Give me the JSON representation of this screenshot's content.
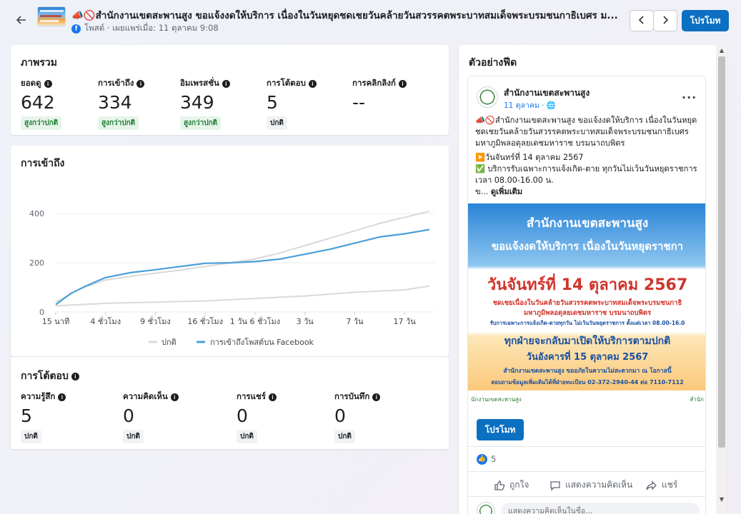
{
  "header": {
    "post_title": "📣🚫สำนักงานเขตสะพานสูง ขอแจ้งงดให้บริการ เนื่องในวันหยุดชดเชยวันคล้ายวันสวรรคตพระบาทสมเด็จพระบรมชนกาธิเบศร ม...",
    "post_meta": "โพสต์ · เผยแพร่เมื่อ: 11 ตุลาคม 9:08",
    "promote_label": "โปรโมท",
    "icons": {
      "back": "arrow-left-icon",
      "prev": "chevron-left-icon",
      "next": "chevron-right-icon",
      "facebook": "facebook-icon"
    }
  },
  "overview": {
    "title": "ภาพรวม",
    "metrics": [
      {
        "label": "ยอดดู",
        "value": "642",
        "status": "สูงกว่าปกติ",
        "level": "up"
      },
      {
        "label": "การเข้าถึง",
        "value": "334",
        "status": "สูงกว่าปกติ",
        "level": "up"
      },
      {
        "label": "อิมเพรสชั่น",
        "value": "349",
        "status": "สูงกว่าปกติ",
        "level": "up"
      },
      {
        "label": "การโต้ตอบ",
        "value": "5",
        "status": "ปกติ",
        "level": "norm"
      },
      {
        "label": "การคลิกลิงก์",
        "value": "--",
        "status": "",
        "level": "none"
      }
    ]
  },
  "reach_chart": {
    "title": "การเข้าถึง",
    "legend_normal": "ปกติ",
    "legend_series": "การเข้าถึงโพสต์บน Facebook",
    "colors": {
      "series": "#4a9fd8",
      "normal": "#d9d9d9"
    }
  },
  "chart_data": {
    "type": "line",
    "title": "การเข้าถึง",
    "x_ticks": [
      "15 นาที",
      "4 ชั่วโมง",
      "9 ชั่วโมง",
      "16 ชั่วโมง",
      "1 วัน 6 ชั่วโมง",
      "3 วัน",
      "7 วัน",
      "17 วัน"
    ],
    "x_tick_positions": [
      0,
      1,
      2,
      3,
      4,
      5,
      6,
      7
    ],
    "ylim": [
      0,
      450
    ],
    "y_ticks": [
      0,
      200,
      400
    ],
    "grid": true,
    "legend": "bottom",
    "series": [
      {
        "name": "การเข้าถึงโพสต์บน Facebook",
        "x": [
          0,
          0.3,
          0.6,
          1,
          1.5,
          2,
          2.5,
          3,
          3.5,
          4,
          4.5,
          5,
          5.5,
          6,
          6.5,
          7,
          7.5
        ],
        "values": [
          30,
          75,
          105,
          140,
          160,
          172,
          185,
          198,
          200,
          205,
          215,
          235,
          255,
          280,
          305,
          318,
          335
        ]
      },
      {
        "name": "ปกติ",
        "x": [
          0,
          0.5,
          1,
          1.5,
          2,
          2.5,
          3,
          3.5,
          4,
          4.5,
          5,
          5.5,
          6,
          6.5,
          7,
          7.5
        ],
        "values": [
          40,
          95,
          130,
          145,
          158,
          170,
          185,
          200,
          215,
          240,
          270,
          300,
          330,
          360,
          385,
          410
        ]
      },
      {
        "name": "ปกติ-ต่ำ",
        "x": [
          0,
          1,
          2,
          3,
          4,
          5,
          6,
          7,
          7.5
        ],
        "values": [
          25,
          35,
          40,
          45,
          55,
          65,
          80,
          90,
          105
        ]
      }
    ]
  },
  "engagement": {
    "title": "การโต้ตอบ",
    "metrics": [
      {
        "label": "ความรู้สึก",
        "value": "5",
        "status": "ปกติ"
      },
      {
        "label": "ความคิดเห็น",
        "value": "0",
        "status": "ปกติ"
      },
      {
        "label": "การแชร์",
        "value": "0",
        "status": "ปกติ"
      },
      {
        "label": "การบันทึก",
        "value": "0",
        "status": "ปกติ"
      }
    ]
  },
  "feed": {
    "title": "ตัวอย่างฟีด",
    "page_name": "สำนักงานเขตสะพานสูง",
    "date": "11 ตุลาคม · 🌐",
    "text_line1": "📣🚫สำนักงานเขตสะพานสูง ขอแจ้งงดให้บริการ เนื่องในวันหยุดชดเชยวันคล้ายวันสวรรคตพระบาทสมเด็จพระบรมชนกาธิเบศร มหาภูมิพลอดุลยเดชมหาราช บรมนาถบพิตร",
    "text_line2": "▶️วันจันทร์ที่ 14 ตุลาคม 2567",
    "text_line3": "✅ บริการรับเฉพาะการแจ้งเกิด-ตาย ทุกวันไม่เว้นวันหยุดราชการ เวลา 08.00-16.00 น.",
    "text_line4_prefix": "ข... ",
    "see_more": "ดูเพิ่มเติม",
    "image": {
      "line1": "สำนักงานเขตสะพานสูง",
      "line2": "ขอแจ้งงดให้บริการ เนื่องในวันหยุดราชกา",
      "line3": "วันจันทร์ที่ 14 ตุลาคม 2567",
      "line4": "ชดเชยเนื่องในวันคล้ายวันสวรรคตพระบาทสมเด็จพระบรมชนกาธิ",
      "line5": "มหาภูมิพลอดุลยเดชมหาราช บรมนาถบพิตร",
      "line6": "รับการเฉพาะการแจ้งเกิด-ตายทุกวัน ไม่เว้นวันหยุดราชการ ตั้งแต่เวลา 08.00-16.0",
      "line7": "ทุกฝ่ายจะกลับมาเปิดให้บริการตามปกติ",
      "line8": "วันอังคารที่ 15 ตุลาคม 2567",
      "line9": "สำนักงานเขตสะพานสูง ขออภัยในความไม่สะดวกมา ณ โอกาสนี้",
      "line10": "สอบถามข้อมูลเพิ่มเติมได้ที่ฝ่ายทะเบียน 02-372-2940-44 ต่อ 7110-7112",
      "foot_left": "นักงานเขตสะพานสูง",
      "foot_right": "สำนัก"
    },
    "promote_label": "โปรโมท",
    "like_count": "5",
    "actions": {
      "like": "ถูกใจ",
      "comment": "แสดงความคิดเห็น",
      "share": "แชร์"
    },
    "comment_placeholder": "แสดงความคิดเห็นในชื่อ..."
  }
}
